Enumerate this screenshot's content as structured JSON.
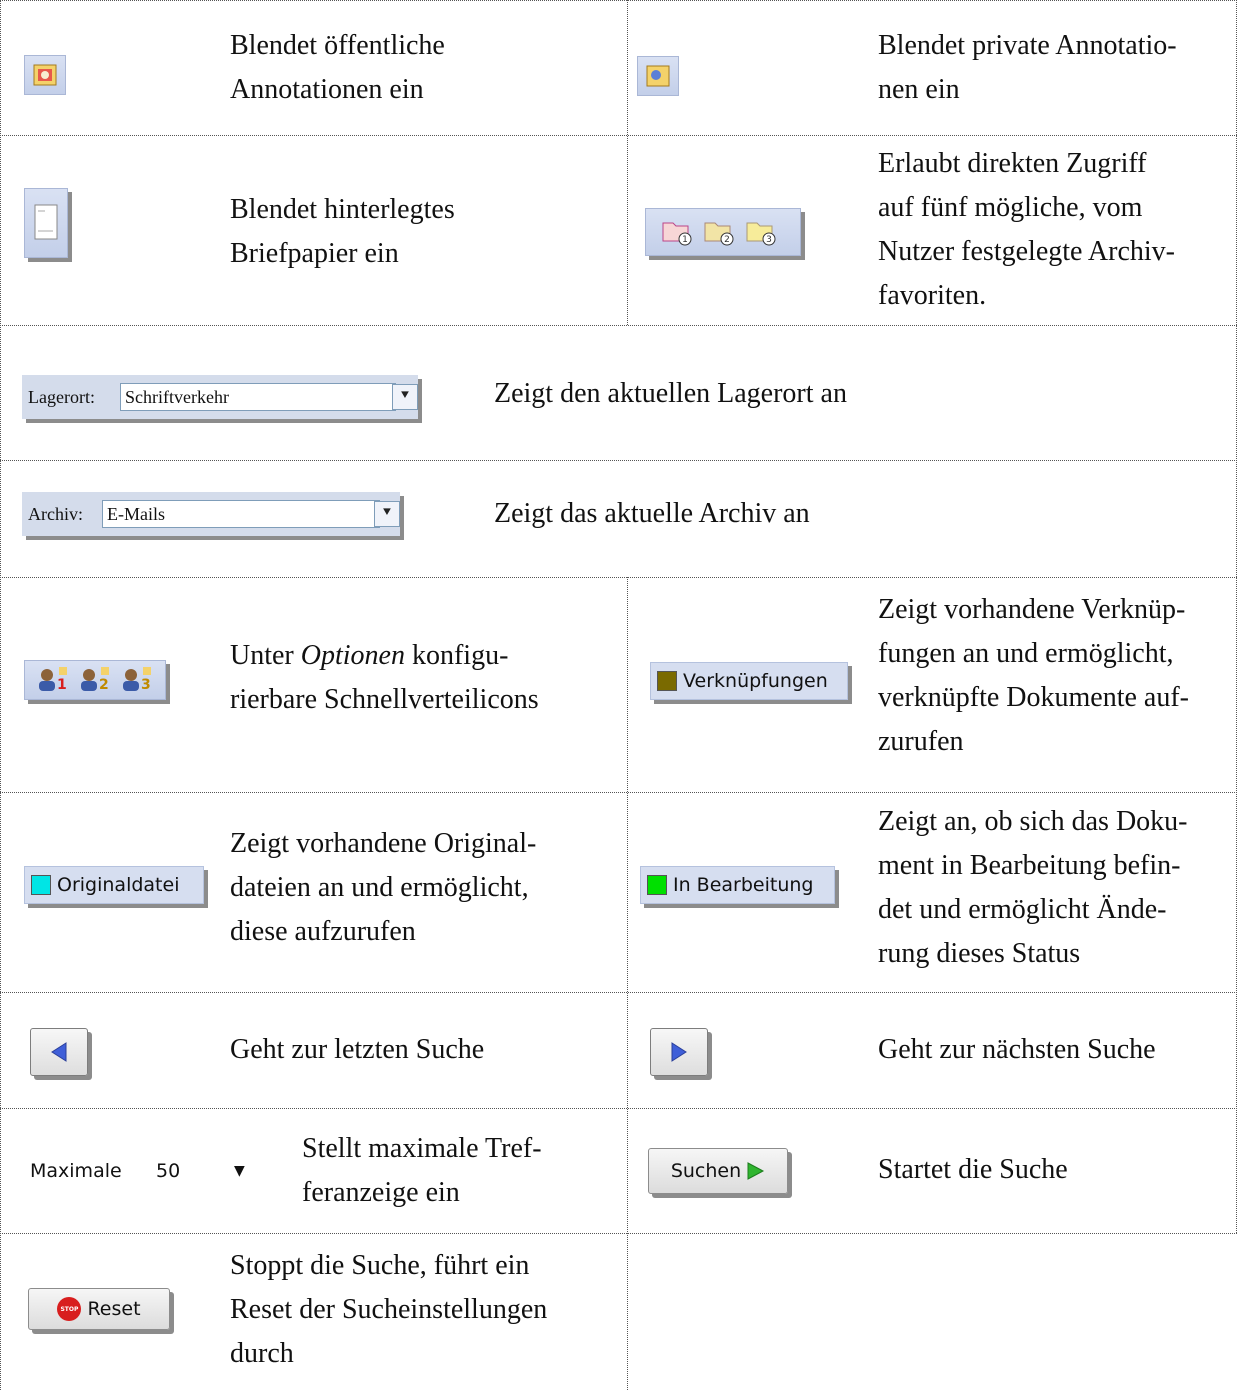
{
  "rows": {
    "r1": {
      "left_text": "Blendet öffentliche\nAnnotationen ein",
      "right_text": "Blendet private Annotatio-\nnen ein"
    },
    "r2": {
      "left_text": "Blendet hinterlegtes\nBriefpapier ein",
      "right_text": "Erlaubt direkten Zugriff\nauf fünf mögliche, vom\nNutzer festgelegte Archiv-\nfavoriten."
    },
    "r3": {
      "combo_label": "Lagerort:",
      "combo_value": "Schriftverkehr",
      "text": "Zeigt den aktuellen Lagerort an"
    },
    "r4": {
      "combo_label": "Archiv:",
      "combo_value": "E-Mails",
      "text": "Zeigt das aktuelle Archiv an"
    },
    "r5": {
      "left_text_pre": "Unter ",
      "left_text_em": "Optionen",
      "left_text_post": " konfigu-\nrierbare Schnellverteilicons",
      "right_button": "Verknüpfungen",
      "right_swatch_color": "#7a6a00",
      "right_text": "Zeigt vorhandene Verknüp-\nfungen an und ermöglicht,\nverknüpfte Dokumente auf-\nzurufen",
      "icon_numbers": [
        "1",
        "2",
        "3"
      ]
    },
    "r6": {
      "left_button": "Originaldatei",
      "left_swatch_color": "#00e5e5",
      "left_text": "Zeigt vorhandene Original-\ndateien an und ermöglicht,\ndiese aufzurufen",
      "right_button": "In Bearbeitung",
      "right_swatch_color": "#00e000",
      "right_text": "Zeigt an, ob sich das Doku-\nment in Bearbeitung befin-\ndet und ermöglicht Ände-\nrung dieses Status"
    },
    "r7": {
      "left_text": "Geht zur letzten Suche",
      "right_text": "Geht zur nächsten Suche"
    },
    "r8": {
      "max_label": "Maximale",
      "max_value": "50",
      "left_text": "Stellt maximale Tref-\nferanzeige ein",
      "search_button": "Suchen",
      "right_text": "Startet die Suche"
    },
    "r9": {
      "reset_button": "Reset",
      "stop_badge": "STOP",
      "left_text": "Stoppt die Suche, führt ein\nReset der Sucheinstellungen\ndurch"
    }
  },
  "colors": {
    "arrow_blue": "#3f5fd8",
    "play_green": "#2fb52f",
    "stop_red": "#d81e1e"
  }
}
